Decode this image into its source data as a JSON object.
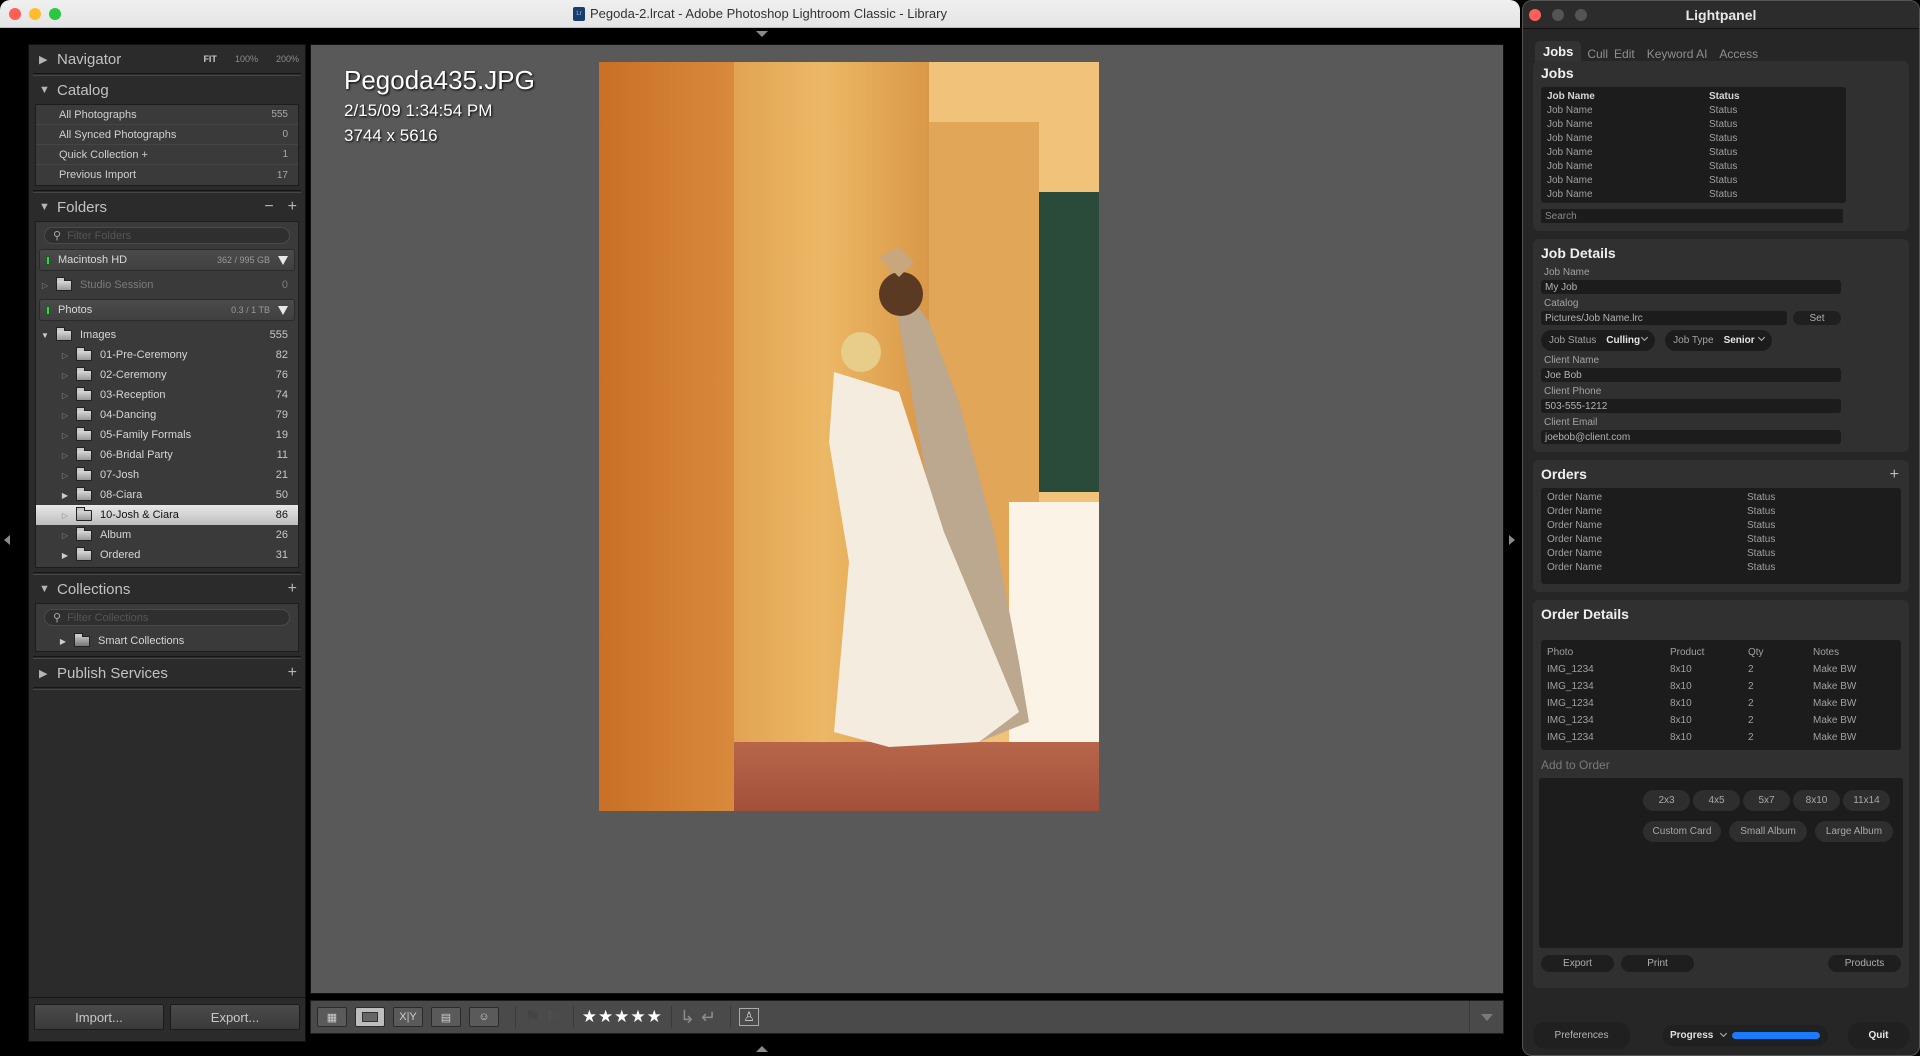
{
  "lightroom": {
    "window_title": "Pegoda-2.lrcat - Adobe Photoshop Lightroom Classic - Library",
    "left_panel": {
      "navigator": {
        "title": "Navigator",
        "zoom_fit": "FIT",
        "zoom_100": "100%",
        "zoom_200": "200%"
      },
      "catalog": {
        "title": "Catalog",
        "items": [
          {
            "label": "All Photographs",
            "count": "555"
          },
          {
            "label": "All Synced Photographs",
            "count": "0"
          },
          {
            "label": "Quick Collection +",
            "count": "1"
          },
          {
            "label": "Previous Import",
            "count": "17"
          }
        ]
      },
      "folders": {
        "title": "Folders",
        "filter_placeholder": "Filter Folders",
        "volumes": [
          {
            "name": "Macintosh HD",
            "size": "362 / 995 GB"
          },
          {
            "name": "Photos",
            "size": "0.3 / 1 TB"
          }
        ],
        "studio_session": {
          "name": "Studio Session",
          "count": "0"
        },
        "images": {
          "name": "Images",
          "count": "555"
        },
        "items": [
          {
            "name": "01-Pre-Ceremony",
            "count": "82"
          },
          {
            "name": "02-Ceremony",
            "count": "76"
          },
          {
            "name": "03-Reception",
            "count": "74"
          },
          {
            "name": "04-Dancing",
            "count": "79"
          },
          {
            "name": "05-Family Formals",
            "count": "19"
          },
          {
            "name": "06-Bridal Party",
            "count": "11"
          },
          {
            "name": "07-Josh",
            "count": "21"
          },
          {
            "name": "08-Ciara",
            "count": "50"
          },
          {
            "name": "10-Josh & Ciara",
            "count": "86",
            "selected": true
          },
          {
            "name": "Album",
            "count": "26"
          },
          {
            "name": "Ordered",
            "count": "31"
          }
        ]
      },
      "collections": {
        "title": "Collections",
        "filter_placeholder": "Filter Collections",
        "smart": "Smart Collections"
      },
      "publish": {
        "title": "Publish Services"
      },
      "import_label": "Import...",
      "export_label": "Export..."
    },
    "photo_info": {
      "filename": "Pegoda435.JPG",
      "datetime": "2/15/09 1:34:54 PM",
      "dimensions": "3744 x 5616"
    },
    "toolbar": {
      "rating_stars": "★★★★★",
      "rating": 5
    }
  },
  "lightpanel": {
    "title": "Lightpanel",
    "tabs": [
      "Jobs",
      "Cull",
      "Edit",
      "Keyword AI",
      "Access"
    ],
    "active_tab": "Jobs",
    "jobs": {
      "title": "Jobs",
      "columns": [
        "Job Name",
        "Status"
      ],
      "rows": [
        [
          "Job Name",
          "Status"
        ],
        [
          "Job Name",
          "Status"
        ],
        [
          "Job Name",
          "Status"
        ],
        [
          "Job Name",
          "Status"
        ],
        [
          "Job Name",
          "Status"
        ],
        [
          "Job Name",
          "Status"
        ],
        [
          "Job Name",
          "Status"
        ]
      ],
      "search_placeholder": "Search"
    },
    "job_details": {
      "title": "Job Details",
      "job_name_label": "Job Name",
      "job_name": "My Job",
      "catalog_label": "Catalog",
      "catalog": "Pictures/Job Name.lrc",
      "set_label": "Set",
      "job_status_label": "Job Status",
      "job_status": "Culling",
      "job_type_label": "Job Type",
      "job_type": "Senior",
      "client_name_label": "Client Name",
      "client_name": "Joe Bob",
      "client_phone_label": "Client Phone",
      "client_phone": "503-555-1212",
      "client_email_label": "Client Email",
      "client_email": "joebob@client.com"
    },
    "orders": {
      "title": "Orders",
      "rows": [
        [
          "Order Name",
          "Status"
        ],
        [
          "Order Name",
          "Status"
        ],
        [
          "Order Name",
          "Status"
        ],
        [
          "Order Name",
          "Status"
        ],
        [
          "Order Name",
          "Status"
        ],
        [
          "Order Name",
          "Status"
        ]
      ]
    },
    "order_details": {
      "title": "Order Details",
      "columns": [
        "Photo",
        "Product",
        "Qty",
        "Notes"
      ],
      "rows": [
        [
          "IMG_1234",
          "8x10",
          "2",
          "Make BW"
        ],
        [
          "IMG_1234",
          "8x10",
          "2",
          "Make BW"
        ],
        [
          "IMG_1234",
          "8x10",
          "2",
          "Make BW"
        ],
        [
          "IMG_1234",
          "8x10",
          "2",
          "Make BW"
        ],
        [
          "IMG_1234",
          "8x10",
          "2",
          "Make BW"
        ]
      ],
      "add_to_order": "Add to Order",
      "products_row1": [
        "2x3",
        "4x5",
        "5x7",
        "8x10",
        "11x14"
      ],
      "products_row2": [
        "Custom Card",
        "Small Album",
        "Large Album"
      ],
      "export_label": "Export",
      "print_label": "Print",
      "products_label": "Products"
    },
    "footer": {
      "preferences": "Preferences",
      "progress_label": "Progress",
      "progress_value": 100,
      "quit": "Quit",
      "progress_color": "#1a7bff"
    }
  }
}
